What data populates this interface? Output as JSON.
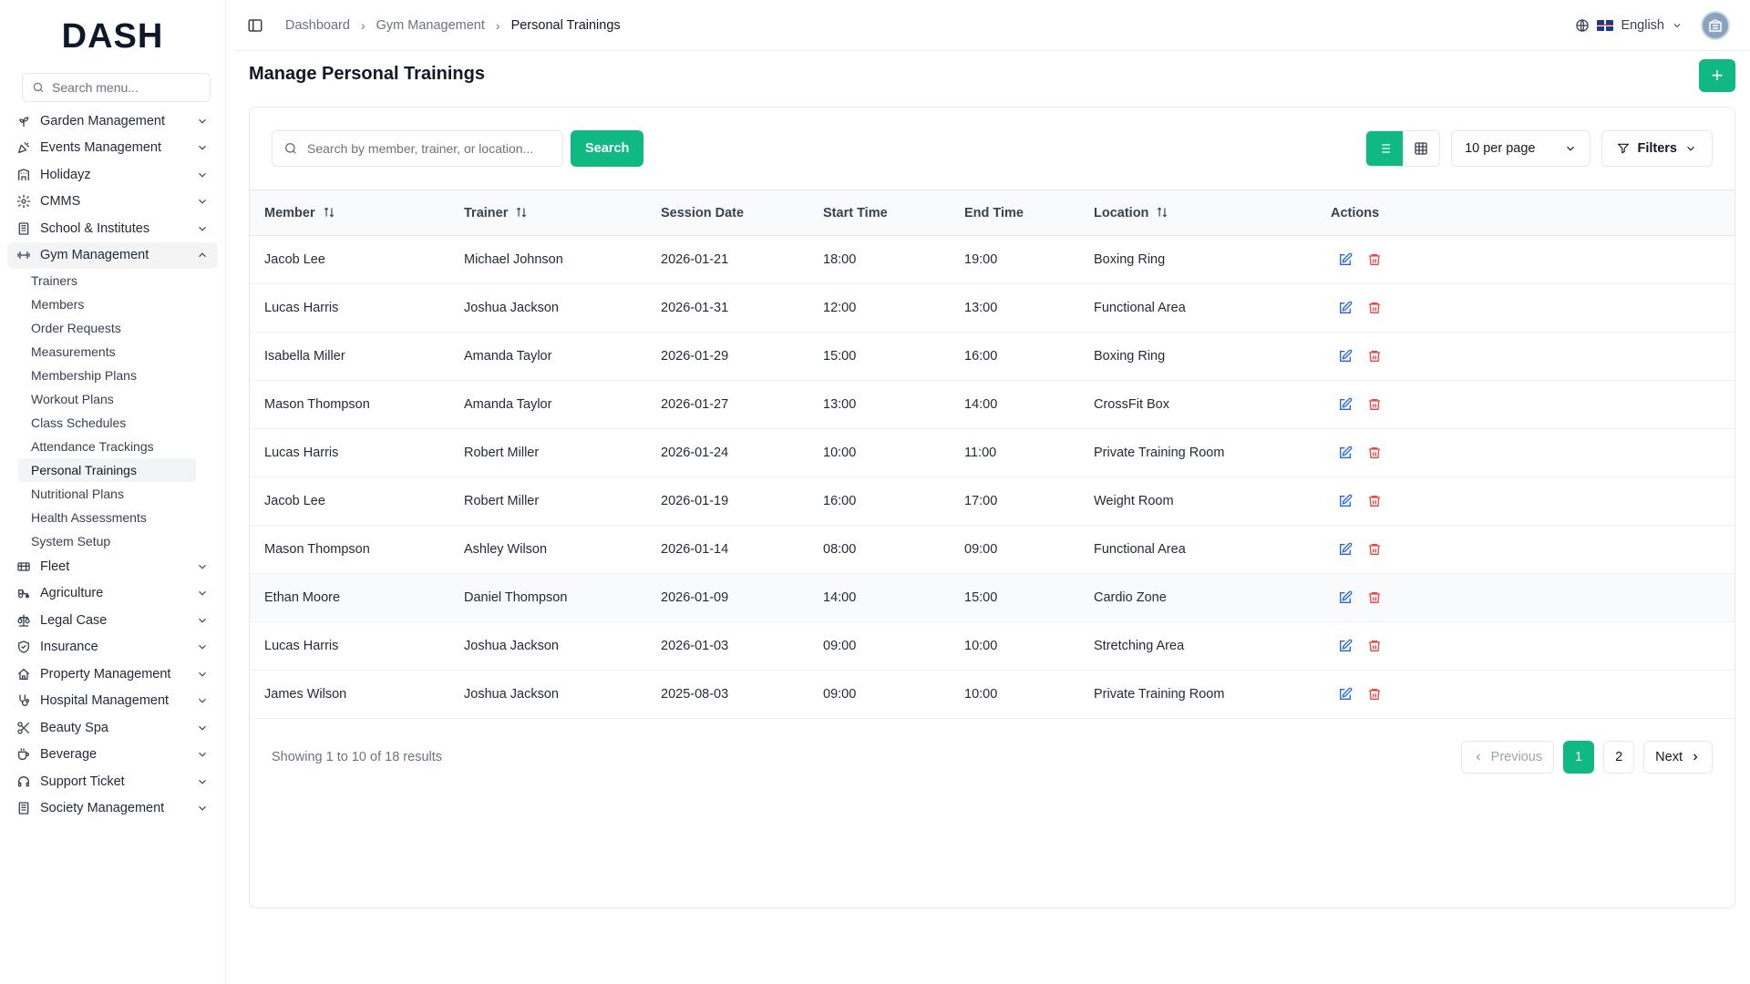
{
  "brand": {
    "logo": "DASH"
  },
  "sidebar": {
    "search_placeholder": "Search menu...",
    "items": [
      {
        "label": "Garden Management",
        "icon": "plant-icon",
        "expanded": false
      },
      {
        "label": "Events Management",
        "icon": "party-icon",
        "expanded": false
      },
      {
        "label": "Holidayz",
        "icon": "hotel-icon",
        "expanded": false
      },
      {
        "label": "CMMS",
        "icon": "gear-icon",
        "expanded": false
      },
      {
        "label": "School & Institutes",
        "icon": "building-icon",
        "expanded": false
      },
      {
        "label": "Gym Management",
        "icon": "dumbbell-icon",
        "expanded": true
      }
    ],
    "gym_sub": [
      {
        "label": "Trainers"
      },
      {
        "label": "Members"
      },
      {
        "label": "Order Requests"
      },
      {
        "label": "Measurements"
      },
      {
        "label": "Membership Plans"
      },
      {
        "label": "Workout Plans"
      },
      {
        "label": "Class Schedules"
      },
      {
        "label": "Attendance Trackings"
      },
      {
        "label": "Personal Trainings",
        "active": true
      },
      {
        "label": "Nutritional Plans"
      },
      {
        "label": "Health Assessments"
      },
      {
        "label": "System Setup"
      }
    ],
    "items_after": [
      {
        "label": "Fleet",
        "icon": "truck-icon"
      },
      {
        "label": "Agriculture",
        "icon": "tractor-icon"
      },
      {
        "label": "Legal Case",
        "icon": "scale-icon"
      },
      {
        "label": "Insurance",
        "icon": "shield-icon"
      },
      {
        "label": "Property Management",
        "icon": "property-icon"
      },
      {
        "label": "Hospital Management",
        "icon": "stethoscope-icon"
      },
      {
        "label": "Beauty Spa",
        "icon": "scissors-icon"
      },
      {
        "label": "Beverage",
        "icon": "cup-icon"
      },
      {
        "label": "Support Ticket",
        "icon": "headset-icon"
      },
      {
        "label": "Society Management",
        "icon": "building-icon"
      }
    ]
  },
  "header": {
    "breadcrumb": [
      "Dashboard",
      "Gym Management",
      "Personal Trainings"
    ],
    "language": "English"
  },
  "page": {
    "title": "Manage Personal Trainings",
    "add_label": "+"
  },
  "toolbar": {
    "search_placeholder": "Search by member, trainer, or location...",
    "search_button": "Search",
    "per_page": "10 per page",
    "filters": "Filters"
  },
  "table": {
    "columns": [
      "Member",
      "Trainer",
      "Session Date",
      "Start Time",
      "End Time",
      "Location",
      "Actions"
    ],
    "rows": [
      {
        "member": "Jacob Lee",
        "trainer": "Michael Johnson",
        "date": "2026-01-21",
        "start": "18:00",
        "end": "19:00",
        "location": "Boxing Ring"
      },
      {
        "member": "Lucas Harris",
        "trainer": "Joshua Jackson",
        "date": "2026-01-31",
        "start": "12:00",
        "end": "13:00",
        "location": "Functional Area"
      },
      {
        "member": "Isabella Miller",
        "trainer": "Amanda Taylor",
        "date": "2026-01-29",
        "start": "15:00",
        "end": "16:00",
        "location": "Boxing Ring"
      },
      {
        "member": "Mason Thompson",
        "trainer": "Amanda Taylor",
        "date": "2026-01-27",
        "start": "13:00",
        "end": "14:00",
        "location": "CrossFit Box"
      },
      {
        "member": "Lucas Harris",
        "trainer": "Robert Miller",
        "date": "2026-01-24",
        "start": "10:00",
        "end": "11:00",
        "location": "Private Training Room"
      },
      {
        "member": "Jacob Lee",
        "trainer": "Robert Miller",
        "date": "2026-01-19",
        "start": "16:00",
        "end": "17:00",
        "location": "Weight Room"
      },
      {
        "member": "Mason Thompson",
        "trainer": "Ashley Wilson",
        "date": "2026-01-14",
        "start": "08:00",
        "end": "09:00",
        "location": "Functional Area"
      },
      {
        "member": "Ethan Moore",
        "trainer": "Daniel Thompson",
        "date": "2026-01-09",
        "start": "14:00",
        "end": "15:00",
        "location": "Cardio Zone"
      },
      {
        "member": "Lucas Harris",
        "trainer": "Joshua Jackson",
        "date": "2026-01-03",
        "start": "09:00",
        "end": "10:00",
        "location": "Stretching Area"
      },
      {
        "member": "James Wilson",
        "trainer": "Joshua Jackson",
        "date": "2025-08-03",
        "start": "09:00",
        "end": "10:00",
        "location": "Private Training Room"
      }
    ]
  },
  "footer": {
    "showing": "Showing 1 to 10 of 18 results",
    "previous": "Previous",
    "next": "Next",
    "pages": [
      "1",
      "2"
    ],
    "current_page": "1"
  },
  "colors": {
    "accent": "#10b981",
    "edit": "#2563eb",
    "delete": "#ef4444"
  }
}
